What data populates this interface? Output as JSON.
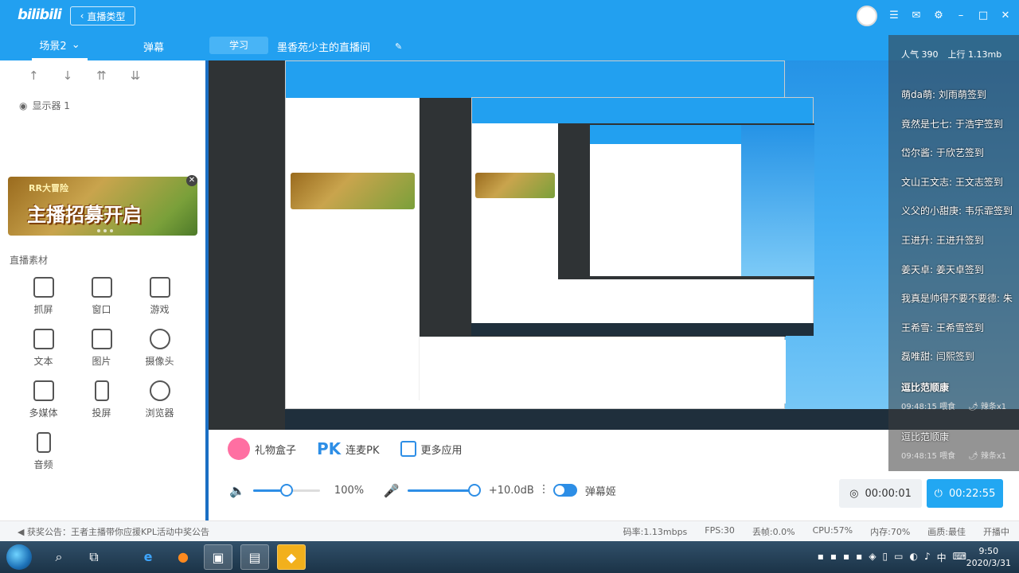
{
  "app": {
    "logo": "bilibili",
    "back_label": "直播类型"
  },
  "scenebar": {
    "scene_label": "场景2",
    "danmaku_tab": "弹幕",
    "category_tag": "学习",
    "room_title": "墨香苑少主的直播间"
  },
  "left": {
    "display_label": "显示器 1",
    "banner_small": "RR大冒险",
    "banner_text": "主播招募开启",
    "section_title": "直播素材",
    "items": [
      {
        "label": "抓屏",
        "icon": "crop-icon"
      },
      {
        "label": "窗口",
        "icon": "window-icon"
      },
      {
        "label": "游戏",
        "icon": "gamepad-icon"
      },
      {
        "label": "文本",
        "icon": "text-icon"
      },
      {
        "label": "图片",
        "icon": "image-icon"
      },
      {
        "label": "摄像头",
        "icon": "camera-icon"
      },
      {
        "label": "多媒体",
        "icon": "media-icon"
      },
      {
        "label": "投屏",
        "icon": "phone-icon"
      },
      {
        "label": "浏览器",
        "icon": "browser-icon"
      },
      {
        "label": "音频",
        "icon": "music-icon"
      }
    ]
  },
  "bottom": {
    "gift_box": "礼物盒子",
    "pk_icon_text": "PK",
    "pk": "连麦PK",
    "more_apps": "更多应用",
    "volume_percent": "100%",
    "volume_level": 0.5,
    "mic_gain": "+10.0dB",
    "mic_level": 1.0,
    "danmaku_toggle": "弹幕姬",
    "timer_record": "00:00:01",
    "timer_live": "00:22:55"
  },
  "status": {
    "notice": "获奖公告：王者主播带你应援KPL活动中奖公告",
    "bitrate": "码率:1.13mbps",
    "fps": "FPS:30",
    "dropped": "丢帧:0.0%",
    "cpu": "CPU:57%",
    "memory": "内存:70%",
    "quality": "画质:最佳",
    "live_status": "开播中"
  },
  "danmaku": {
    "popularity_label": "人气",
    "popularity": "390",
    "upload_label": "上行",
    "upload": "1.13mb",
    "lines": [
      "萌da萌: 刘雨萌签到",
      "竟然是七七: 于浩宇签到",
      "岱尔酱: 于欣艺签到",
      "文山王文志: 王文志签到",
      "义父的小甜庚: 韦乐霏签到",
      "王进升: 王进升签到",
      "姜天卓: 姜天卓签到",
      "我真是帅得不要不要德: 朱",
      "王希雪: 王希雪签到",
      "磊唯甜: 闫熙签到"
    ],
    "gift_user": "逗比范顺康",
    "gift_time": "09:48:15 喂食",
    "gift_item": "辣条x1"
  },
  "taskbar": {
    "time": "9:50",
    "date": "2020/3/31",
    "ime": "中"
  }
}
